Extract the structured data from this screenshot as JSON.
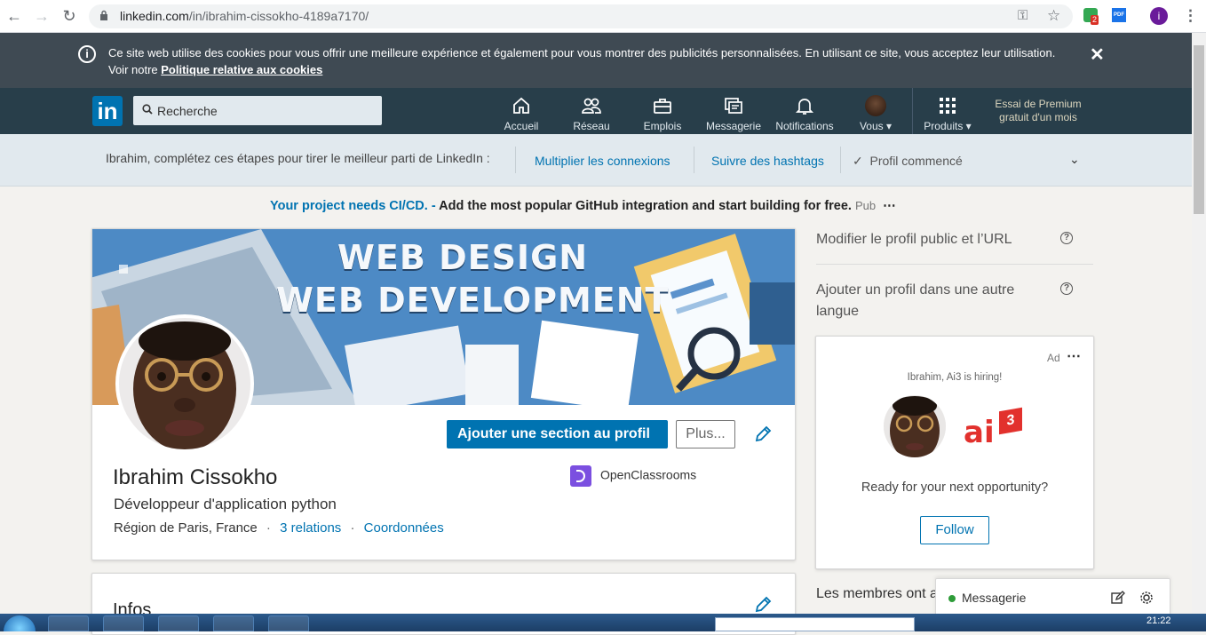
{
  "browser": {
    "url_host": "linkedin.com",
    "url_path": "/in/ibrahim-cissokho-4189a7170/",
    "ext_badge": "2",
    "ext_pdf": "PDF",
    "profile_initial": "i"
  },
  "cookie_banner": {
    "text": "Ce site web utilise des cookies pour vous offrir une meilleure expérience et également pour vous montrer des publicités personnalisées. En utilisant ce site, vous acceptez leur utilisation. Voir notre ",
    "link": "Politique relative aux cookies"
  },
  "nav": {
    "logo": "in",
    "search_placeholder": "Recherche",
    "items": [
      {
        "label": "Accueil",
        "icon": "home-icon"
      },
      {
        "label": "Réseau",
        "icon": "network-icon"
      },
      {
        "label": "Emplois",
        "icon": "briefcase-icon"
      },
      {
        "label": "Messagerie",
        "icon": "messaging-icon"
      },
      {
        "label": "Notifications",
        "icon": "bell-icon"
      },
      {
        "label": "Vous",
        "icon": "avatar"
      },
      {
        "label": "Produits",
        "icon": "grid-icon"
      }
    ],
    "premium_line1": "Essai de Premium",
    "premium_line2": "gratuit d'un mois"
  },
  "completion": {
    "lead": "Ibrahim, complétez ces étapes pour tirer le meilleur parti de LinkedIn :",
    "step1": "Multiplier les connexions",
    "step2": "Suivre des hashtags",
    "step3": "Profil commencé"
  },
  "ad_line": {
    "highlight": "Your project needs CI/CD. -",
    "text": " Add the most popular GitHub integration and start building for free.",
    "tag": "Pub"
  },
  "profile": {
    "banner_line1": "WEB DESIGN",
    "banner_line2": "WEB DEVELOPMENT",
    "add_section": "Ajouter une section au profil",
    "more": "Plus...",
    "name": "Ibrahim Cissokho",
    "headline": "Développeur d'application python",
    "location": "Région de Paris, France",
    "relations": "3 relations",
    "contact": "Coordonnées",
    "organization": "OpenClassrooms"
  },
  "infos": {
    "title": "Infos"
  },
  "right_rail": {
    "link1": "Modifier le profil public et l’URL",
    "link2": "Ajouter un profil dans une autre langue",
    "ad": {
      "label": "Ad",
      "hiring": "Ibrahim, Ai3 is hiring!",
      "brand": "ai",
      "brand_sup": "3",
      "ready": "Ready for your next opportunity?",
      "follow": "Follow"
    },
    "members": "Les membres ont a"
  },
  "messaging": {
    "label": "Messagerie"
  },
  "taskbar": {
    "time": "21:22"
  },
  "colors": {
    "linkedin_blue": "#0073b1",
    "nav_bg": "#283e4a",
    "cookie_bg": "#3f4a53",
    "completion_bg": "#e1e9ee"
  }
}
